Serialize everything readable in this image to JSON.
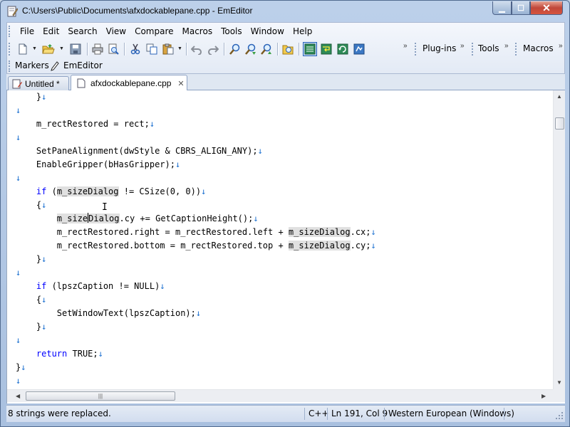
{
  "window": {
    "title": "C:\\Users\\Public\\Documents\\afxdockablepane.cpp - EmEditor"
  },
  "menu": [
    "File",
    "Edit",
    "Search",
    "View",
    "Compare",
    "Macros",
    "Tools",
    "Window",
    "Help"
  ],
  "toolbar": {
    "plugins_label": "Plug-ins",
    "tools_label": "Tools",
    "macros_label": "Macros",
    "markers_label": "Markers",
    "emeditor_label": "EmEditor"
  },
  "tabs": [
    {
      "label": "Untitled *",
      "active": false
    },
    {
      "label": "afxdockablepane.cpp",
      "active": true
    }
  ],
  "code_lines": [
    "    }↓",
    "↓",
    "    m_rectRestored = rect;↓",
    "↓",
    "    SetPaneAlignment(dwStyle & CBRS_ALIGN_ANY);↓",
    "    EnableGripper(bHasGripper);↓",
    "↓",
    "    if (m_sizeDialog != CSize(0, 0))↓",
    "    {↓",
    "        m_sizeDialog.cy += GetCaptionHeight();↓",
    "        m_rectRestored.right = m_rectRestored.left + m_sizeDialog.cx;↓",
    "        m_rectRestored.bottom = m_rectRestored.top + m_sizeDialog.cy;↓",
    "    }↓",
    "↓",
    "    if (lpszCaption != NULL)↓",
    "    {↓",
    "        SetWindowText(lpszCaption);↓",
    "    }↓",
    "↓",
    "    return TRUE;↓",
    "}↓",
    "↓"
  ],
  "status": {
    "message": "8 strings were replaced.",
    "language": "C++",
    "position": "Ln 191, Col 9",
    "encoding": "Western European (Windows)"
  },
  "colors": {
    "keyword": "#0000ff",
    "newline_mark": "#1a6fd0",
    "highlight": "#e0e0e0"
  },
  "icons": [
    "new-file-icon",
    "open-folder-icon",
    "save-icon",
    "print-icon",
    "print-preview-icon",
    "cut-icon",
    "copy-icon",
    "paste-icon",
    "undo-icon",
    "redo-icon",
    "find-icon",
    "find-next-icon",
    "find-previous-icon",
    "find-in-files-icon",
    "view-marks-icon",
    "word-wrap-icon",
    "refresh-icon",
    "toggle-icon"
  ]
}
